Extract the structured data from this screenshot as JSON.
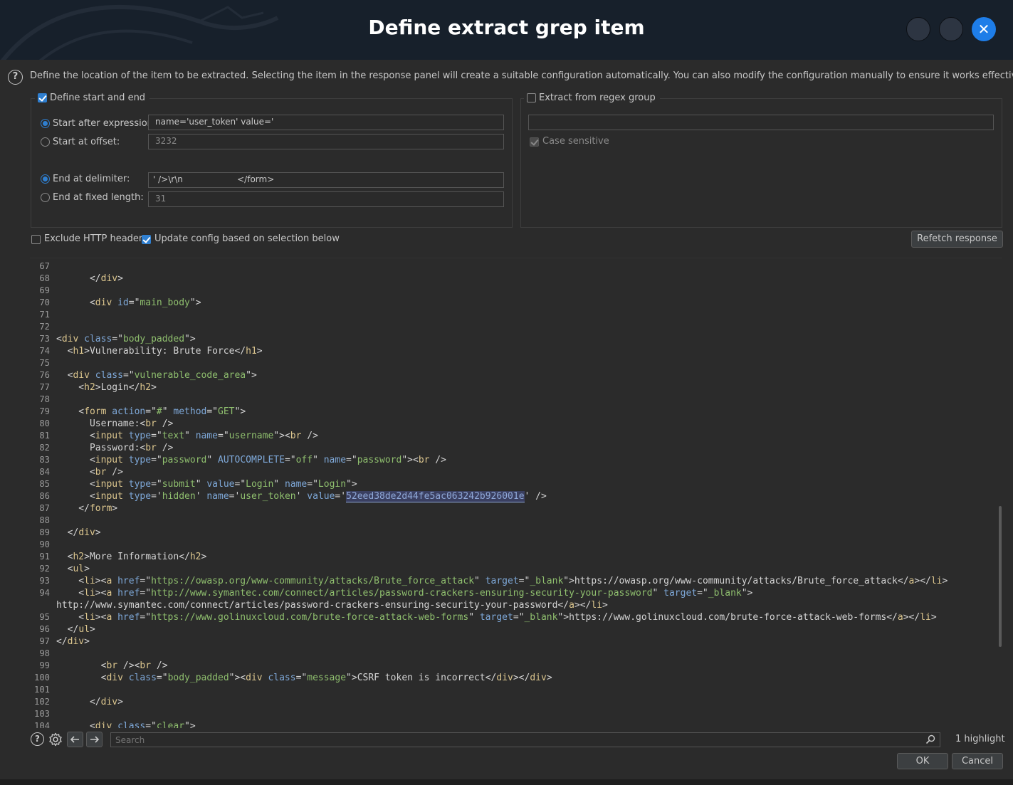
{
  "dialog": {
    "title": "Define extract grep item",
    "close_glyph": "✕"
  },
  "help": {
    "icon": "help-circle-icon",
    "glyph": "?",
    "description": "Define the location of the item to be extracted. Selecting the item in the response panel will create a suitable configuration automatically. You can also modify the configuration manually to ensure it works effectively."
  },
  "start_end": {
    "enabled": true,
    "label": "Define start and end",
    "start_after_label": "Start after expression:",
    "start_after_value": "name='user_token' value='",
    "start_after_selected": true,
    "start_offset_label": "Start at offset:",
    "start_offset_value": "3232",
    "end_delim_label": "End at delimiter:",
    "end_delim_value": "' />\\r\\n                    </form>",
    "end_delim_selected": true,
    "end_fixed_label": "End at fixed length:",
    "end_fixed_value": "31"
  },
  "regex": {
    "enabled": false,
    "label": "Extract from regex group",
    "value": "",
    "case_sensitive_label": "Case sensitive",
    "case_sensitive": true
  },
  "options": {
    "exclude_headers_label": "Exclude HTTP headers",
    "exclude_headers": false,
    "update_config_label": "Update config based on selection below",
    "update_config": true,
    "refetch_label": "Refetch response"
  },
  "editor": {
    "line_numbers": [
      "67",
      "68",
      "69",
      "70",
      "71",
      "72",
      "73",
      "74",
      "75",
      "76",
      "77",
      "78",
      "79",
      "80",
      "81",
      "82",
      "83",
      "84",
      "85",
      "86",
      "87",
      "88",
      "89",
      "90",
      "91",
      "92",
      "93",
      "94",
      "",
      "95",
      "96",
      "97",
      "98",
      "99",
      "100",
      "101",
      "102",
      "103",
      "104"
    ],
    "highlighted_token": "52eed38de2d44fe5ac063242b926001e"
  },
  "search": {
    "placeholder": "Search",
    "highlight_count": "1 highlight"
  },
  "footer": {
    "ok_label": "OK",
    "cancel_label": "Cancel"
  },
  "colors": {
    "accent": "#2f7fd0",
    "close_button": "#1e7de8",
    "title_bg": "#17202b",
    "tag": "#dcc68e",
    "attr": "#7ea8d8",
    "value": "#8fbf6e"
  }
}
